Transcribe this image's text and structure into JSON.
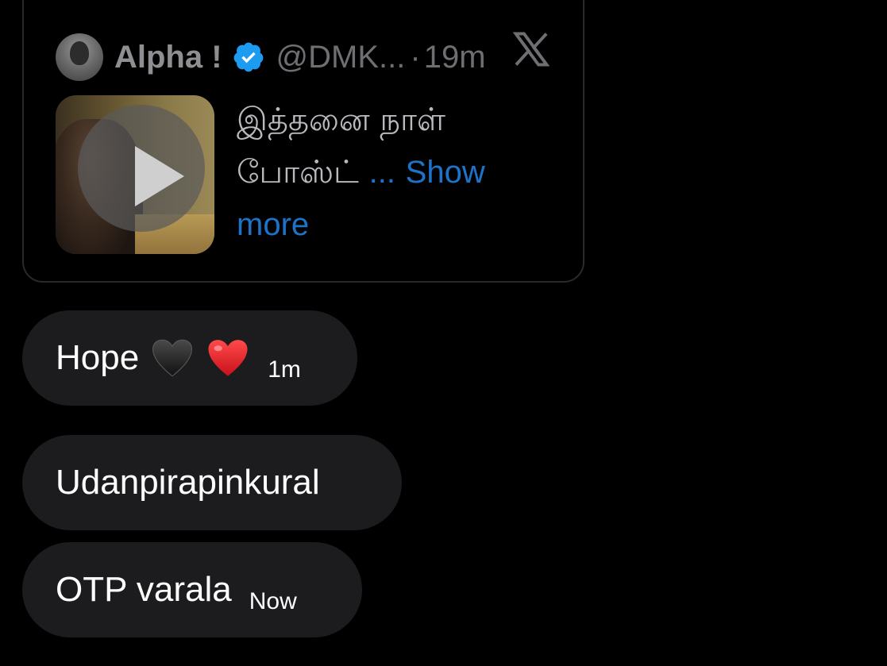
{
  "tweet_card": {
    "author_name": "Alpha !",
    "handle": "@DMK...",
    "separator": "·",
    "time_ago": "19m",
    "text_main": "இத்தனை நாள் போஸ்ட் ",
    "ellipsis": "...",
    "show_more": "Show more",
    "verified_color": "#1d9bf0",
    "link_color": "#1d73c8"
  },
  "messages": [
    {
      "text": "Hope",
      "emojis": [
        "black-heart",
        "red-heart"
      ],
      "time": "1m"
    },
    {
      "text": "Udanpirapinkural",
      "time": ""
    },
    {
      "text": "OTP varala",
      "time": "Now"
    }
  ],
  "colors": {
    "background": "#000000",
    "bubble": "#1c1c1e",
    "card_border": "#2a2a2c"
  }
}
